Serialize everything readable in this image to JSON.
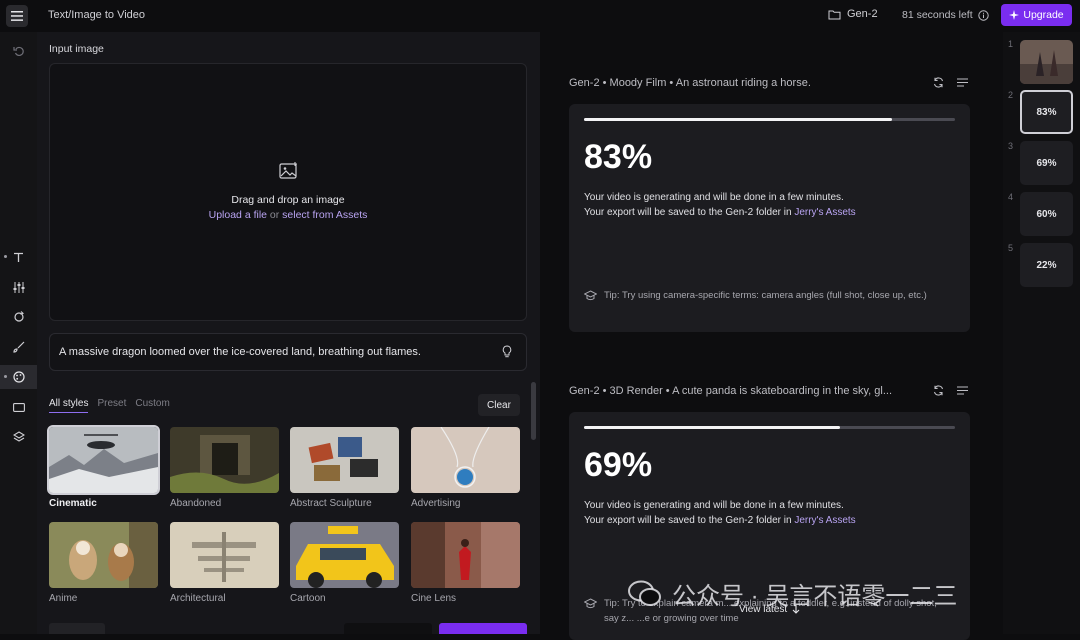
{
  "topbar": {
    "title": "Text/Image to Video",
    "folder": "Gen-2",
    "seconds_left": "81 seconds left",
    "upgrade": "Upgrade"
  },
  "input": {
    "label": "Input image",
    "drag_text": "Drag and drop an image",
    "upload_link": "Upload a file",
    "or_text": " or ",
    "assets_link": "select from Assets",
    "prompt": "A massive dragon loomed over the ice-covered land, breathing out flames."
  },
  "style_tabs": [
    "All styles",
    "Preset",
    "Custom"
  ],
  "clear_label": "Clear",
  "styles": [
    {
      "name": "Cinematic",
      "selected": true
    },
    {
      "name": "Abandoned"
    },
    {
      "name": "Abstract Sculpture"
    },
    {
      "name": "Advertising"
    },
    {
      "name": "Anime"
    },
    {
      "name": "Architectural"
    },
    {
      "name": "Cartoon"
    },
    {
      "name": "Cine Lens"
    }
  ],
  "generations": [
    {
      "header": "Gen-2 • Moody Film • An astronaut riding a horse.",
      "progress": 83,
      "percent_label": "83%",
      "line1": "Your video is generating and will be done in a few minutes.",
      "line2_pre": "Your export will be saved to the Gen-2 folder in ",
      "line2_link": "Jerry's Assets",
      "tip": "Tip: Try using camera-specific terms: camera angles (full shot, close up, etc.)"
    },
    {
      "header": "Gen-2 • 3D Render • A cute panda is skateboarding in the sky, gl...",
      "progress": 69,
      "percent_label": "69%",
      "line1": "Your video is generating and will be done in a few minutes.",
      "line2_pre": "Your export will be saved to the Gen-2 folder in ",
      "line2_link": "Jerry's Assets",
      "tip": "Tip: Try to explain camera m... explaining to a toddler, e.g. instead of dolly shot, say z... ...e or growing over time"
    }
  ],
  "queue": [
    {
      "num": "1",
      "label": ""
    },
    {
      "num": "2",
      "label": "83%"
    },
    {
      "num": "3",
      "label": "69%"
    },
    {
      "num": "4",
      "label": "60%"
    },
    {
      "num": "5",
      "label": "22%"
    }
  ],
  "view_latest": "View latest",
  "watermark": "公众号 · 吴言不语零一二三",
  "colors": {
    "accent": "#7a2df0",
    "link": "#b9a4f2"
  }
}
